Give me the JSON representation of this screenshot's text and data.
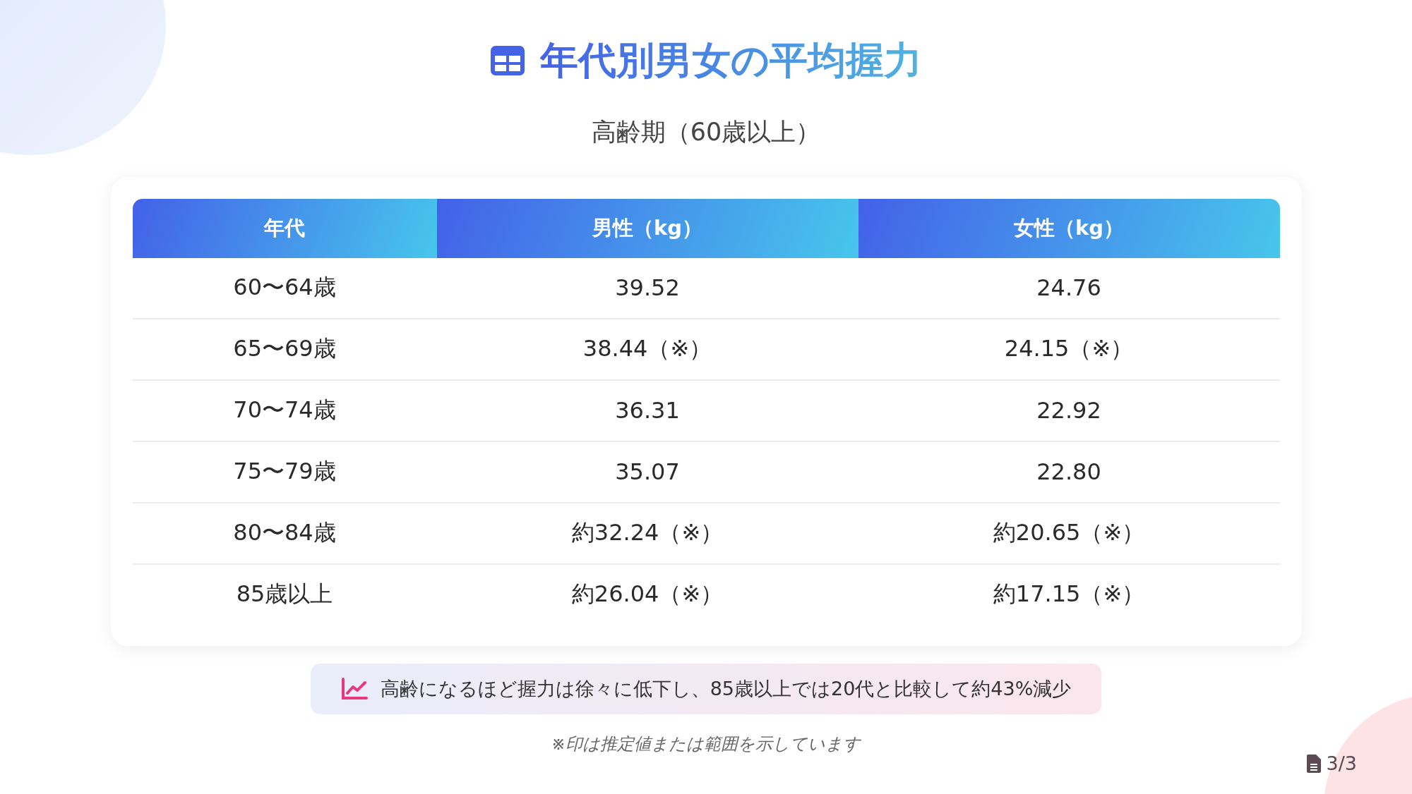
{
  "title": "年代別男女の平均握力",
  "subtitle": "高齢期（60歳以上）",
  "table": {
    "columns": [
      "年代",
      "男性（kg）",
      "女性（kg）"
    ],
    "rows": [
      [
        "60〜64歳",
        "39.52",
        "24.76"
      ],
      [
        "65〜69歳",
        "38.44（※）",
        "24.15（※）"
      ],
      [
        "70〜74歳",
        "36.31",
        "22.92"
      ],
      [
        "75〜79歳",
        "35.07",
        "22.80"
      ],
      [
        "80〜84歳",
        "約32.24（※）",
        "約20.65（※）"
      ],
      [
        "85歳以上",
        "約26.04（※）",
        "約17.15（※）"
      ]
    ]
  },
  "note": "高齢になるほど握力は徐々に低下し、85歳以上では20代と比較して約43%減少",
  "footnote": "※印は推定値または範囲を示しています",
  "page": "3/3"
}
